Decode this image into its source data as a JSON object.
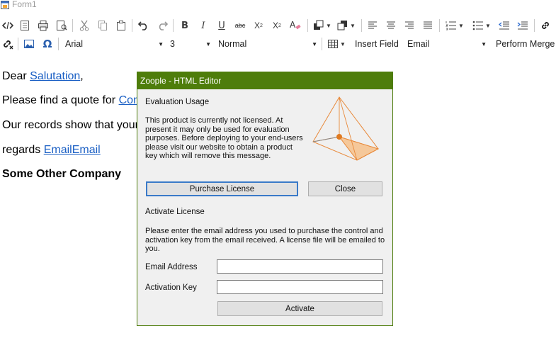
{
  "window": {
    "title": "Form1"
  },
  "toolbar": {
    "font_name": "Arial",
    "font_size": "3",
    "paragraph_style": "Normal",
    "insert_field_label": "Insert Field",
    "field_value": "Email",
    "perform_merge_label": "Perform Merge",
    "icons": [
      "source-code-icon",
      "document-icon",
      "print-icon",
      "print-preview-icon",
      "cut-icon",
      "copy-icon",
      "paste-icon",
      "undo-icon",
      "redo-icon",
      "bold-icon",
      "italic-icon",
      "underline-icon",
      "strikethrough-icon",
      "superscript-icon",
      "subscript-icon",
      "clear-format-icon",
      "text-color-icon",
      "highlight-color-icon",
      "align-left-icon",
      "align-center-icon",
      "align-right-icon",
      "justify-icon",
      "numbered-list-icon",
      "bullet-list-icon",
      "outdent-icon",
      "indent-icon",
      "link-icon",
      "unlink-icon",
      "image-icon",
      "omega-icon",
      "table-icon"
    ]
  },
  "document": {
    "line1_prefix": "Dear ",
    "line1_field": "Salutation",
    "line1_suffix": ",",
    "line2_prefix": "Please find a quote for ",
    "line2_field": "Com",
    "line3_prefix": "Our records show that your",
    "line4_prefix": "regards ",
    "line4_field": "EmailEmail",
    "line5": "Some Other Company"
  },
  "dialog": {
    "title": "Zoople - HTML Editor",
    "eval_heading": "Evaluation Usage",
    "eval_text_lines": [
      "This product is currently not licensed. At",
      "present it may only be used for evaluation",
      "purposes. Before  deploying to your end-users",
      "please visit our website to obtain a product",
      "key which will remove this message."
    ],
    "purchase_label": "Purchase License",
    "close_label": "Close",
    "activate_heading": "Activate License",
    "activate_text_lines": [
      "Please enter the email address you used to purchase the control and",
      "activation key from the email received. A license file will be emailed to",
      "you."
    ],
    "email_label": "Email Address",
    "email_value": "",
    "key_label": "Activation Key",
    "key_value": "",
    "activate_label": "Activate",
    "logo_colors": {
      "stroke": "#e8893a",
      "fill": "#f5c89a",
      "dot": "#e07a20"
    }
  }
}
